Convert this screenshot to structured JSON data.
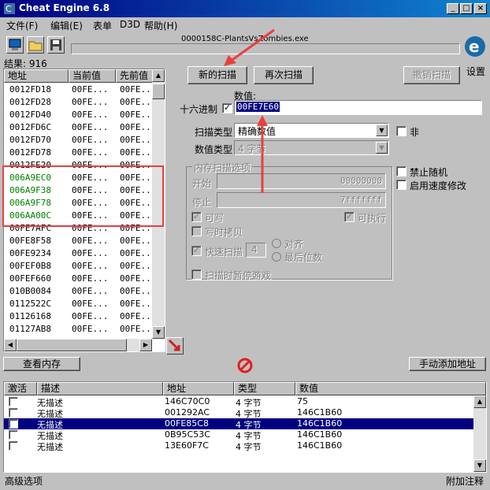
{
  "window": {
    "title": "Cheat Engine 6.8",
    "process": "0000158C-PlantsVsZombies.exe"
  },
  "menu": [
    "文件(F)",
    "编辑(E)",
    "表单",
    "D3D",
    "帮助(H)"
  ],
  "results": {
    "label": "结果: 916"
  },
  "scan_list": {
    "headers": [
      "地址",
      "当前值",
      "先前值"
    ],
    "rows": [
      {
        "address": "0012FD18",
        "current": "00FE...",
        "previous": "00FE..."
      },
      {
        "address": "0012FD28",
        "current": "00FE...",
        "previous": "00FE..."
      },
      {
        "address": "0012FD40",
        "current": "00FE...",
        "previous": "00FE..."
      },
      {
        "address": "0012FD6C",
        "current": "00FE...",
        "previous": "00FE..."
      },
      {
        "address": "0012FD70",
        "current": "00FE...",
        "previous": "00FE..."
      },
      {
        "address": "0012FD78",
        "current": "00FE...",
        "previous": "00FE..."
      },
      {
        "address": "0012FE20",
        "current": "00FE...",
        "previous": "00FE..."
      },
      {
        "address": "006A9EC0",
        "current": "00FE...",
        "previous": "00FE..."
      },
      {
        "address": "006A9F38",
        "current": "00FE...",
        "previous": "00FE..."
      },
      {
        "address": "006A9F78",
        "current": "00FE...",
        "previous": "00FE..."
      },
      {
        "address": "006AA00C",
        "current": "00FE...",
        "previous": "00FE..."
      },
      {
        "address": "00FE7AFC",
        "current": "00FE...",
        "previous": "00FE..."
      },
      {
        "address": "00FE8F58",
        "current": "00FE...",
        "previous": "00FE..."
      },
      {
        "address": "00FE9234",
        "current": "00FE...",
        "previous": "00FE..."
      },
      {
        "address": "00FEF0B8",
        "current": "00FE...",
        "previous": "00FE..."
      },
      {
        "address": "00FEF660",
        "current": "00FE...",
        "previous": "00FE..."
      },
      {
        "address": "010B0084",
        "current": "00FE...",
        "previous": "00FE..."
      },
      {
        "address": "0112522C",
        "current": "00FE...",
        "previous": "00FE..."
      },
      {
        "address": "01126168",
        "current": "00FE...",
        "previous": "00FE..."
      },
      {
        "address": "01127AB8",
        "current": "00FE...",
        "previous": "00FE..."
      }
    ],
    "highlight_color": "#008000"
  },
  "buttons": {
    "new_scan": "新的扫描",
    "next_scan": "再次扫描",
    "undo_scan": "撤销扫描",
    "view_memory": "查看内存",
    "add_address": "手动添加地址"
  },
  "settings_label": "设置",
  "value": {
    "label": "数值:",
    "hex_label": "十六进制",
    "hex_checked": true,
    "input": "00FE7E60"
  },
  "scan_type": {
    "label": "扫描类型",
    "selected": "精确数值"
  },
  "value_type": {
    "label": "数值类型",
    "selected": "4 字节"
  },
  "not_label": "非",
  "memory_options": {
    "title": "内存扫描选项",
    "start_label": "开始",
    "start_value": "00000000",
    "stop_label": "停止",
    "stop_value": "7fffffff",
    "writable": "可写",
    "executable": "可执行",
    "copy_on_write": "写时拷贝",
    "fast_scan": "快速扫描",
    "fast_scan_value": "4",
    "align": "对齐",
    "last_digits": "最后位数",
    "pause_game": "扫描时暂停游戏"
  },
  "disable_random": "禁止随机",
  "speed_hack": "启用速度修改",
  "address_table": {
    "headers": [
      "激活",
      "描述",
      "地址",
      "类型",
      "数值"
    ],
    "rows": [
      {
        "description": "无描述",
        "address": "146C70C0",
        "type": "4 字节",
        "value": "75"
      },
      {
        "description": "无描述",
        "address": "001292AC",
        "type": "4 字节",
        "value": "146C1B60"
      },
      {
        "description": "无描述",
        "address": "00FE85C8",
        "type": "4 字节",
        "value": "146C1B60"
      },
      {
        "description": "无描述",
        "address": "0B95C53C",
        "type": "4 字节",
        "value": "146C1B60"
      },
      {
        "description": "无描述",
        "address": "13E60F7C",
        "type": "4 字节",
        "value": "146C1B60"
      }
    ],
    "selected_row": 2
  },
  "status": {
    "left": "高级选项",
    "right": "附加注释"
  },
  "colors": {
    "title_start": "#000080",
    "title_end": "#1084d0",
    "selection": "#000080",
    "annotation": "#e84040"
  }
}
